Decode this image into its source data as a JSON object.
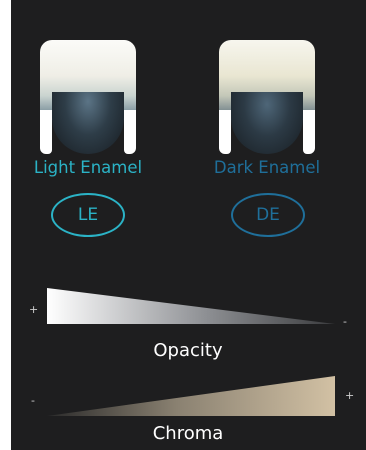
{
  "shades": [
    {
      "label": "Light Enamel",
      "badge": "LE",
      "color": "#2bb3c6"
    },
    {
      "label": "Dark Enamel",
      "badge": "DE",
      "color": "#1f6f9a"
    }
  ],
  "scales": [
    {
      "label": "Opacity",
      "left_sign": "+",
      "right_sign": "-",
      "gradient": [
        "#ffffff",
        "#3a3b3d"
      ]
    },
    {
      "label": "Chroma",
      "left_sign": "-",
      "right_sign": "+",
      "gradient": [
        "#2a2a2a",
        "#d2c1a4"
      ]
    }
  ],
  "colors": {
    "background": "#1e1e1f"
  }
}
